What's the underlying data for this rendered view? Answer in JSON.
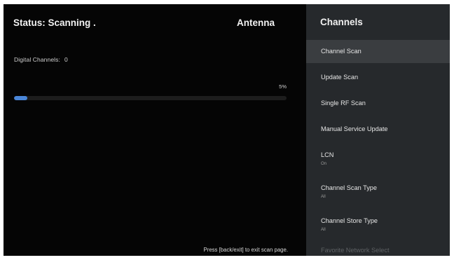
{
  "status": {
    "text": "Status: Scanning .",
    "source": "Antenna",
    "digital_label": "Digital Channels:",
    "digital_count": "0",
    "progress_percent_text": "5%",
    "progress_value": 0.05,
    "hint": "Press [back/exit] to exit scan page."
  },
  "colors": {
    "progress_fill": "#4a86d8",
    "panel_bg": "#26292c",
    "selected_bg": "#3a3d40"
  },
  "panel": {
    "title": "Channels",
    "items": [
      {
        "label": "Channel Scan",
        "value": ""
      },
      {
        "label": "Update Scan",
        "value": ""
      },
      {
        "label": "Single RF Scan",
        "value": ""
      },
      {
        "label": "Manual Service Update",
        "value": ""
      },
      {
        "label": "LCN",
        "value": "On"
      },
      {
        "label": "Channel Scan Type",
        "value": "All"
      },
      {
        "label": "Channel Store Type",
        "value": "All"
      },
      {
        "label": "Favorite Network Select",
        "value": ""
      }
    ]
  }
}
